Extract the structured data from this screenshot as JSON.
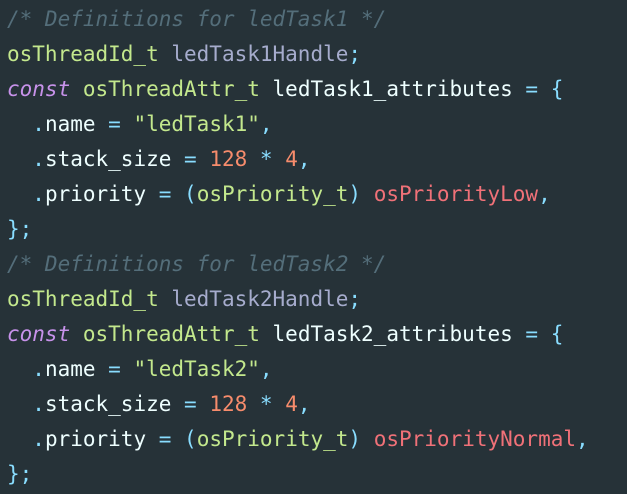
{
  "colors": {
    "background": "#263238",
    "comment": "#546E7A",
    "type": "#C3E88D",
    "variable": "#A6ACCD",
    "identifier": "#EEFFFF",
    "keyword": "#C792EA",
    "punctuation": "#89DDFF",
    "string": "#C3E88D",
    "number": "#F78C6C",
    "enum_value": "#F07178"
  },
  "code": {
    "lines": [
      [
        {
          "c": "comment",
          "t": "/* Definitions for ledTask1 */"
        }
      ],
      [
        {
          "c": "type",
          "t": "osThreadId_t"
        },
        {
          "c": "ident",
          "t": " "
        },
        {
          "c": "var",
          "t": "ledTask1Handle"
        },
        {
          "c": "punct",
          "t": ";"
        }
      ],
      [
        {
          "c": "keyword",
          "t": "const"
        },
        {
          "c": "ident",
          "t": " "
        },
        {
          "c": "type",
          "t": "osThreadAttr_t"
        },
        {
          "c": "ident",
          "t": " ledTask1_attributes "
        },
        {
          "c": "punct",
          "t": "= {"
        }
      ],
      [
        {
          "c": "ident",
          "t": "  "
        },
        {
          "c": "punct",
          "t": "."
        },
        {
          "c": "prop",
          "t": "name "
        },
        {
          "c": "punct",
          "t": "= "
        },
        {
          "c": "string",
          "t": "\"ledTask1\""
        },
        {
          "c": "punct",
          "t": ","
        }
      ],
      [
        {
          "c": "ident",
          "t": "  "
        },
        {
          "c": "punct",
          "t": "."
        },
        {
          "c": "prop",
          "t": "stack_size "
        },
        {
          "c": "punct",
          "t": "= "
        },
        {
          "c": "number",
          "t": "128"
        },
        {
          "c": "ident",
          "t": " "
        },
        {
          "c": "punct",
          "t": "*"
        },
        {
          "c": "ident",
          "t": " "
        },
        {
          "c": "number",
          "t": "4"
        },
        {
          "c": "punct",
          "t": ","
        }
      ],
      [
        {
          "c": "ident",
          "t": "  "
        },
        {
          "c": "punct",
          "t": "."
        },
        {
          "c": "prop",
          "t": "priority "
        },
        {
          "c": "punct",
          "t": "= ("
        },
        {
          "c": "type",
          "t": "osPriority_t"
        },
        {
          "c": "punct",
          "t": ")"
        },
        {
          "c": "ident",
          "t": " "
        },
        {
          "c": "enumval",
          "t": "osPriorityLow"
        },
        {
          "c": "punct",
          "t": ","
        }
      ],
      [
        {
          "c": "punct",
          "t": "};"
        }
      ],
      [
        {
          "c": "comment",
          "t": "/* Definitions for ledTask2 */"
        }
      ],
      [
        {
          "c": "type",
          "t": "osThreadId_t"
        },
        {
          "c": "ident",
          "t": " "
        },
        {
          "c": "var",
          "t": "ledTask2Handle"
        },
        {
          "c": "punct",
          "t": ";"
        }
      ],
      [
        {
          "c": "keyword",
          "t": "const"
        },
        {
          "c": "ident",
          "t": " "
        },
        {
          "c": "type",
          "t": "osThreadAttr_t"
        },
        {
          "c": "ident",
          "t": " ledTask2_attributes "
        },
        {
          "c": "punct",
          "t": "= {"
        }
      ],
      [
        {
          "c": "ident",
          "t": "  "
        },
        {
          "c": "punct",
          "t": "."
        },
        {
          "c": "prop",
          "t": "name "
        },
        {
          "c": "punct",
          "t": "= "
        },
        {
          "c": "string",
          "t": "\"ledTask2\""
        },
        {
          "c": "punct",
          "t": ","
        }
      ],
      [
        {
          "c": "ident",
          "t": "  "
        },
        {
          "c": "punct",
          "t": "."
        },
        {
          "c": "prop",
          "t": "stack_size "
        },
        {
          "c": "punct",
          "t": "= "
        },
        {
          "c": "number",
          "t": "128"
        },
        {
          "c": "ident",
          "t": " "
        },
        {
          "c": "punct",
          "t": "*"
        },
        {
          "c": "ident",
          "t": " "
        },
        {
          "c": "number",
          "t": "4"
        },
        {
          "c": "punct",
          "t": ","
        }
      ],
      [
        {
          "c": "ident",
          "t": "  "
        },
        {
          "c": "punct",
          "t": "."
        },
        {
          "c": "prop",
          "t": "priority "
        },
        {
          "c": "punct",
          "t": "= ("
        },
        {
          "c": "type",
          "t": "osPriority_t"
        },
        {
          "c": "punct",
          "t": ")"
        },
        {
          "c": "ident",
          "t": " "
        },
        {
          "c": "enumval",
          "t": "osPriorityNormal"
        },
        {
          "c": "punct",
          "t": ","
        }
      ],
      [
        {
          "c": "punct",
          "t": "};"
        }
      ]
    ]
  }
}
